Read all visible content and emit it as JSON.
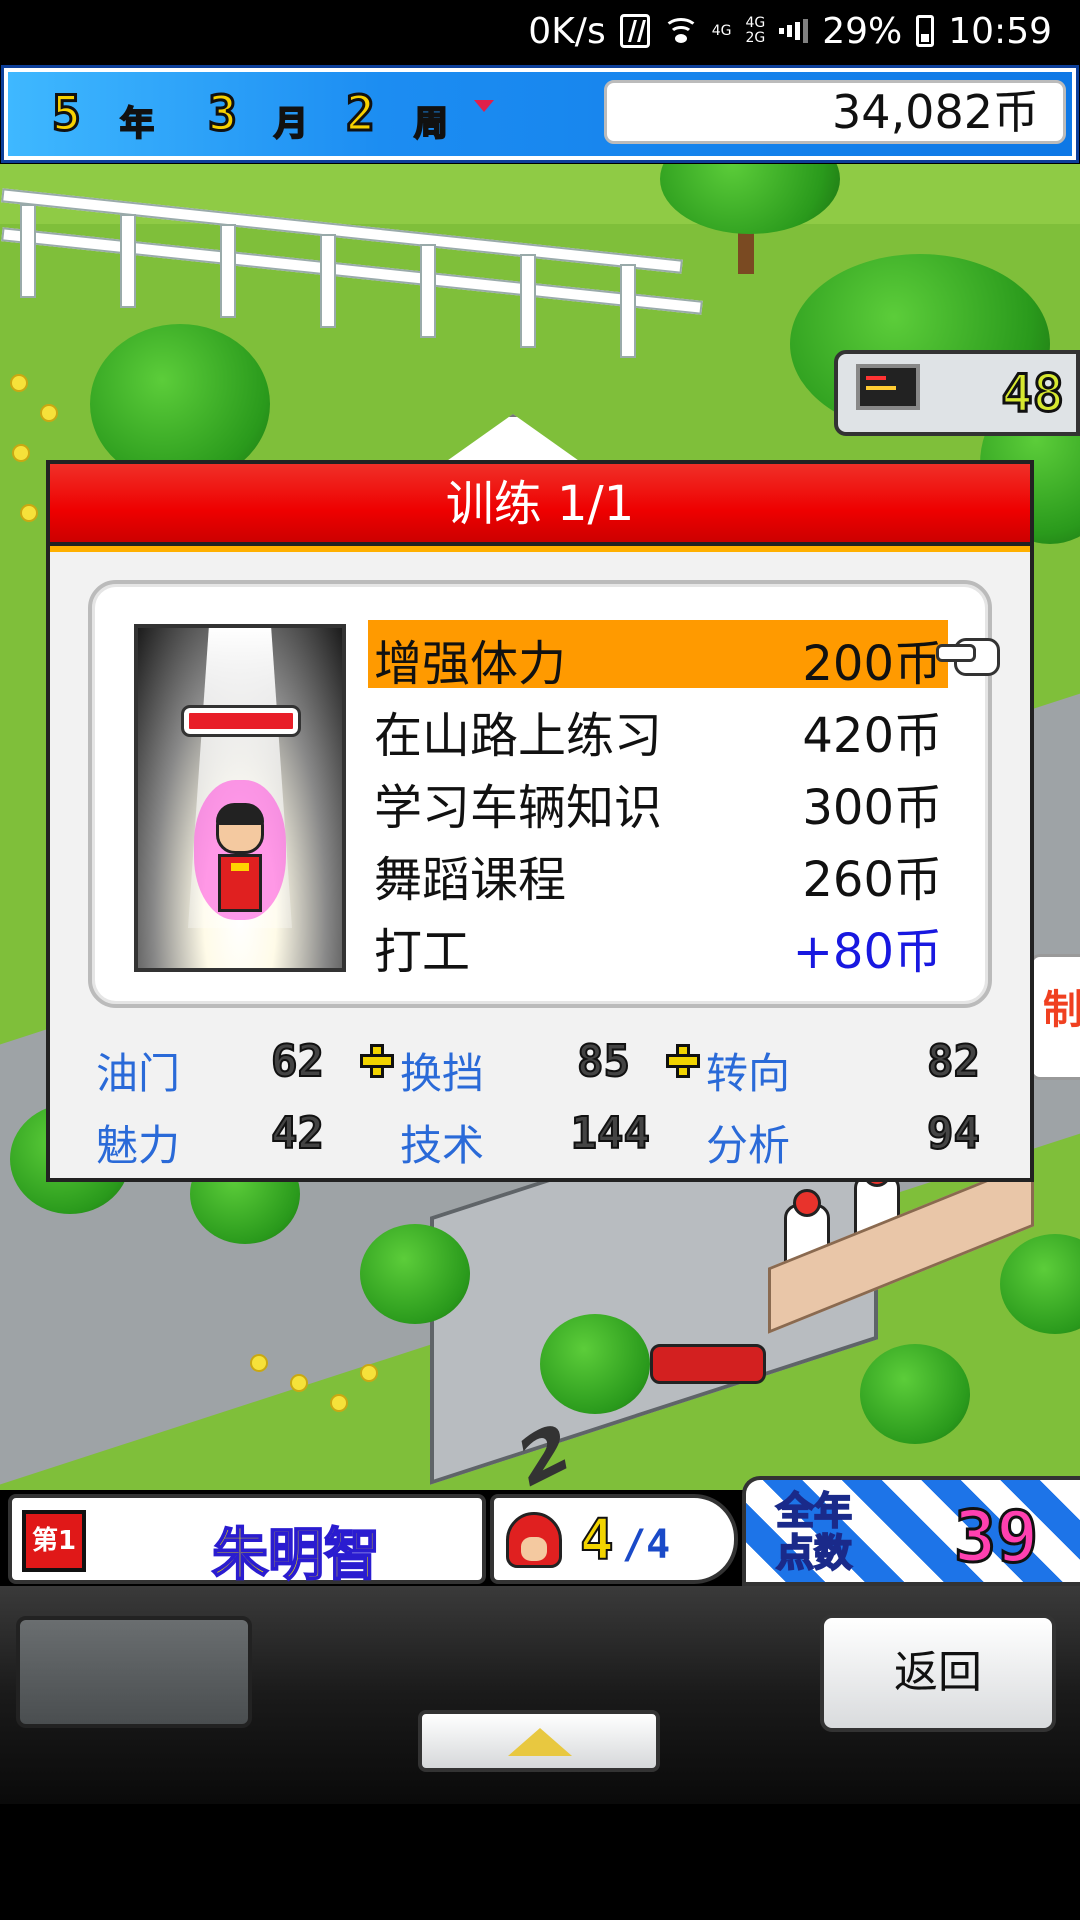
{
  "status_bar": {
    "net_speed": "0K/s",
    "network_labels": [
      "4G",
      "4G",
      "2G"
    ],
    "battery": "29%",
    "time": "10:59",
    "icons": [
      "nfc-icon",
      "wifi-icon",
      "signal-icon",
      "battery-icon"
    ]
  },
  "top_bar": {
    "year": "5",
    "year_unit": "年",
    "month": "3",
    "month_unit": "月",
    "week": "2",
    "week_unit": "周",
    "money": "34,082币"
  },
  "scene": {
    "screen_count": "48",
    "side_sign_char": "制",
    "pit_number": "2"
  },
  "dialog": {
    "title": "训练 1/1",
    "items": [
      {
        "name": "增强体力",
        "cost": "200币",
        "selected": true
      },
      {
        "name": "在山路上练习",
        "cost": "420币"
      },
      {
        "name": "学习车辆知识",
        "cost": "300币"
      },
      {
        "name": "舞蹈课程",
        "cost": "260币"
      },
      {
        "name": "打工",
        "cost": "+80币"
      }
    ],
    "stats": [
      {
        "label": "油门",
        "value": "62",
        "plus": true
      },
      {
        "label": "换挡",
        "value": "85",
        "plus": true
      },
      {
        "label": "转向",
        "value": "82",
        "plus": false
      },
      {
        "label": "魅力",
        "value": "42",
        "plus": false
      },
      {
        "label": "技术",
        "value": "144",
        "plus": false
      },
      {
        "label": "分析",
        "value": "94",
        "plus": false
      }
    ]
  },
  "bottom_info": {
    "rank": "第1",
    "driver_name": "朱明智",
    "crew_count": "4",
    "crew_max": "/4",
    "points_label_line1": "全年",
    "points_label_line2": "点数",
    "points_value": "39"
  },
  "controls": {
    "back_label": "返回"
  },
  "colors": {
    "dialog_header": "#e00000",
    "selected_item": "#ff9a00",
    "stat_label": "#2a6ad8",
    "gain_text": "#1818e0"
  }
}
